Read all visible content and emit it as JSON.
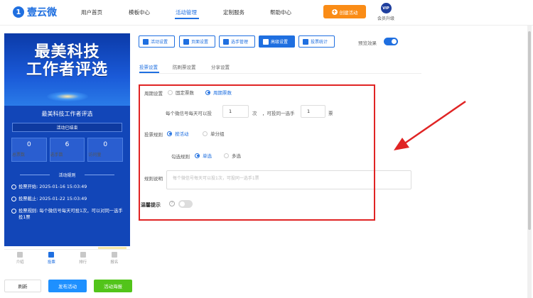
{
  "header": {
    "logo_glyph": "1",
    "logo_text": "壹云微",
    "nav": [
      "用户首页",
      "模板中心",
      "活动管理",
      "定制服务",
      "帮助中心"
    ],
    "create_button": "创建活动",
    "vip_badge": "VIP",
    "vip_label": "会员升级"
  },
  "preview": {
    "banner_line1": "最美科技",
    "banner_line2": "工作者评选",
    "title": "最美科技工作者评选",
    "status": "活动已结束",
    "stats": [
      {
        "value": "0",
        "label": "总票数"
      },
      {
        "value": "6",
        "label": "选手数"
      },
      {
        "value": "0",
        "label": "访问量"
      }
    ],
    "rules_heading": "活动规则",
    "rules": [
      {
        "label": "投票开始:",
        "value": "2025-01-16 15:03:49"
      },
      {
        "label": "投票截止:",
        "value": "2025-01-22 15:03:49"
      },
      {
        "label": "投票规则:",
        "value": "每个微信号每天可投1次，可以对同一选手投1票"
      }
    ],
    "tabs": [
      "介绍",
      "投票",
      "排行",
      "报名"
    ],
    "active_tab": "投票"
  },
  "bottom_buttons": {
    "refresh": "刷新",
    "publish": "发布活动",
    "poster": "活动海报"
  },
  "toolbar": {
    "items": [
      "活动设置",
      "页面设置",
      "选手管理",
      "高级设置",
      "投票统计"
    ],
    "active": "高级设置",
    "preview_label": "预览效果"
  },
  "subtabs": [
    "投票设置",
    "防刷票设置",
    "分享设置"
  ],
  "form": {
    "cycle_label": "周期设置",
    "cycle_options": [
      "固定票数",
      "周期票数"
    ],
    "cycle_selected": "周期票数",
    "per_wechat_prefix": "每个微信号每天可以投",
    "per_day_votes": "1",
    "unit_times": "次",
    "same_player_prefix": "，可投同一选手",
    "same_player_votes": "1",
    "unit_votes": "票",
    "rule_label": "投票规则",
    "rule_options": [
      "按活动",
      "单分组"
    ],
    "rule_selected": "按活动",
    "check_label": "勾选规则",
    "check_options": [
      "单选",
      "多选"
    ],
    "check_selected": "单选",
    "desc_label": "规则说明",
    "desc_placeholder": "每个微信号每天可以投1次，可投同一选手1票",
    "tip_label": "温馨提示",
    "tip_enabled": false
  },
  "colors": {
    "primary": "#1f6fe0",
    "orange": "#fa8c16",
    "green": "#52c41a",
    "highlight_box": "#e02424"
  }
}
